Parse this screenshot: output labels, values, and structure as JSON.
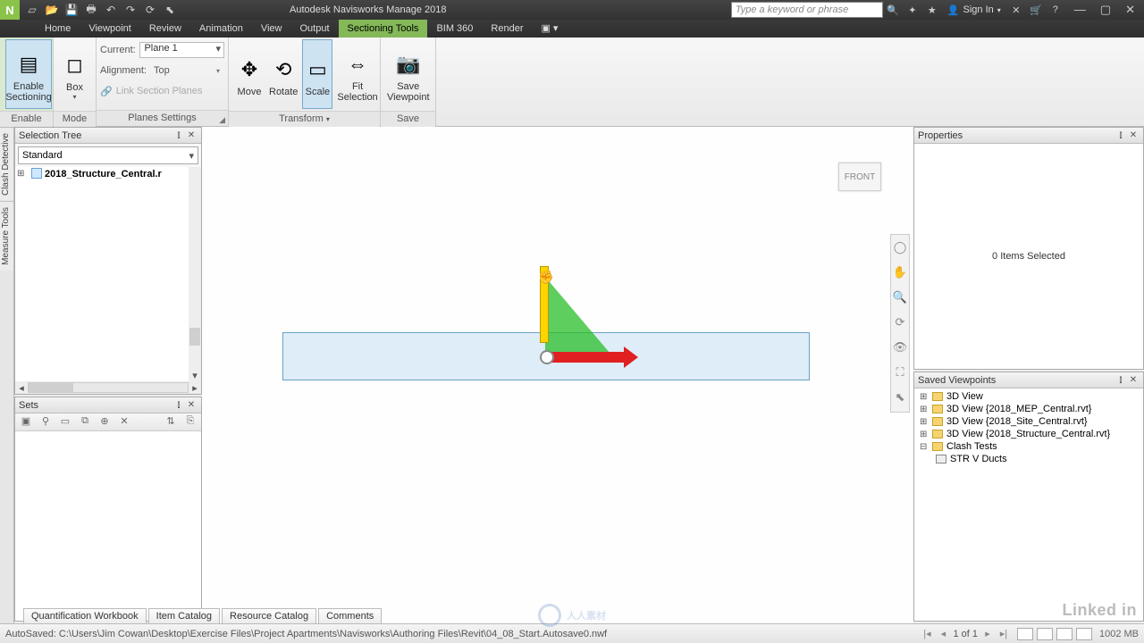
{
  "app": {
    "title": "Autodesk Navisworks Manage 2018",
    "logo": "N"
  },
  "qat": {
    "tips": [
      "new",
      "open",
      "save",
      "print",
      "undo",
      "redo",
      "refresh",
      "select"
    ]
  },
  "search": {
    "placeholder": "Type a keyword or phrase"
  },
  "user": {
    "signin": "Sign In"
  },
  "tabs": [
    "Home",
    "Viewpoint",
    "Review",
    "Animation",
    "View",
    "Output",
    "Sectioning Tools",
    "BIM 360",
    "Render"
  ],
  "active_tab": "Sectioning Tools",
  "ribbon": {
    "enable": {
      "btn": "Enable\nSectioning",
      "group": "Enable"
    },
    "mode": {
      "btn": "Box",
      "group": "Mode"
    },
    "planes": {
      "current_label": "Current:",
      "current_value": "Plane 1",
      "align_label": "Alignment:",
      "align_value": "Top",
      "link_label": "Link Section Planes",
      "group": "Planes Settings"
    },
    "transform": {
      "move": "Move",
      "rotate": "Rotate",
      "scale": "Scale",
      "fit": "Fit\nSelection",
      "group": "Transform"
    },
    "save": {
      "btn": "Save\nViewpoint",
      "group": "Save"
    }
  },
  "left_tabs": [
    "Clash Detective",
    "Measure Tools"
  ],
  "panels": {
    "seltree": {
      "title": "Selection Tree",
      "combo": "Standard",
      "root": "2018_Structure_Central.r"
    },
    "sets": {
      "title": "Sets"
    },
    "properties": {
      "title": "Properties",
      "empty": "0 Items Selected"
    },
    "savedvp": {
      "title": "Saved Viewpoints",
      "items": [
        "3D View",
        "3D View {2018_MEP_Central.rvt}",
        "3D View {2018_Site_Central.rvt}",
        "3D View {2018_Structure_Central.rvt}",
        "Clash Tests"
      ],
      "child": "STR V Ducts"
    }
  },
  "viewcube": "FRONT",
  "bottom_tabs": [
    "Quantification Workbook",
    "Item Catalog",
    "Resource Catalog",
    "Comments"
  ],
  "status": {
    "msg": "AutoSaved: C:\\Users\\Jim Cowan\\Desktop\\Exercise Files\\Project Apartments\\Navisworks\\Authoring Files\\Revit\\04_08_Start.Autosave0.nwf",
    "page": "1 of 1",
    "mem": "1002 MB"
  },
  "watermark_center": "人人素材",
  "watermark_right": "Linked in"
}
